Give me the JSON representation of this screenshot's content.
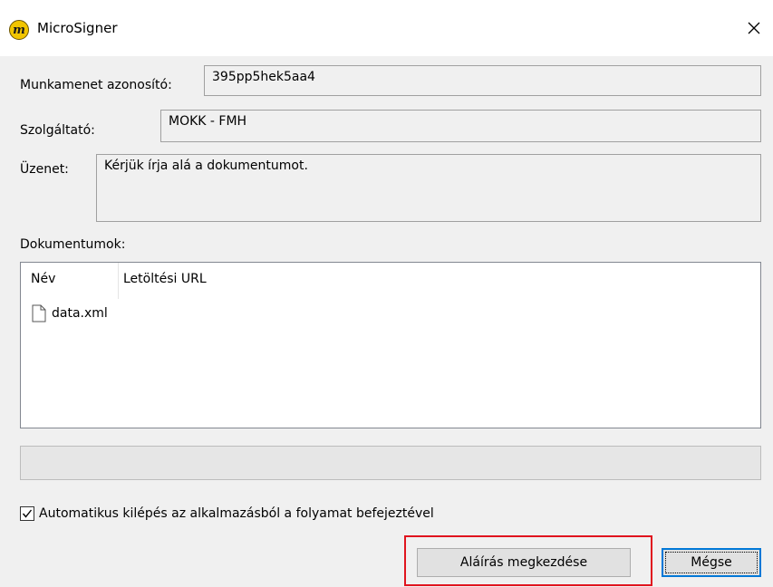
{
  "window": {
    "title": "MicroSigner",
    "logo_letter": "m",
    "close_glyph": "✕"
  },
  "fields": {
    "session_label": "Munkamenet azonosító:",
    "session_value": "395pp5hek5aa4",
    "provider_label": "Szolgáltató:",
    "provider_value": "MOKK - FMH",
    "message_label": "Üzenet:",
    "message_value": "Kérjük írja alá a dokumentumot."
  },
  "documents": {
    "label": "Dokumentumok:",
    "columns": [
      "Név",
      "Letöltési URL"
    ],
    "rows": [
      {
        "name": "data.xml",
        "url": "",
        "icon": "file-icon"
      }
    ]
  },
  "progress": {
    "value": 0
  },
  "auto_exit": {
    "checked": true,
    "label": "Automatikus kilépés az alkalmazásból a folyamat befejeztével"
  },
  "buttons": {
    "sign_label": "Aláírás megkezdése",
    "cancel_label": "Mégse"
  },
  "colors": {
    "highlight": "#e0141e",
    "default_button_border": "#0078d7",
    "logo": "#f2c500"
  }
}
